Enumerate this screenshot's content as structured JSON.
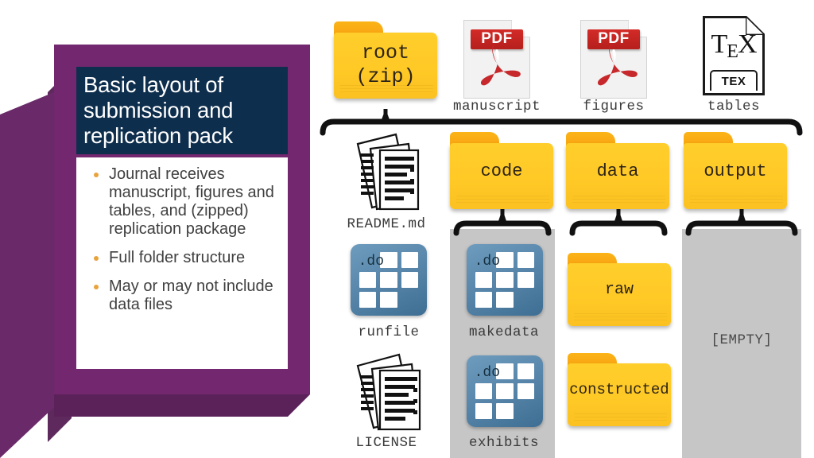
{
  "slide": {
    "title": "Basic layout of submission and replication pack",
    "bullets": [
      "Journal receives manuscript, figures and tables, and (zipped) replication package",
      "Full folder structure",
      "May or may not include data files"
    ],
    "colors": {
      "purple": "#72276F",
      "purple_shadow": "#5E2A5E",
      "navy": "#0E2E4D",
      "bullet_accent": "#E8A33D",
      "folder_body": "#FFCE2B",
      "folder_tab": "#F79C10",
      "pdf_red": "#C32421",
      "do_blue": "#4E7FA4",
      "grey_panel": "#C6C6C6"
    }
  },
  "tree": {
    "root": {
      "label": "root\n(zip)",
      "line1": "root",
      "line2": "(zip)",
      "icon": "folder-icon"
    },
    "top_row": [
      {
        "name": "manuscript",
        "icon": "pdf-file-icon",
        "badge": "PDF"
      },
      {
        "name": "figures",
        "icon": "pdf-file-icon",
        "badge": "PDF"
      },
      {
        "name": "tables",
        "icon": "tex-file-icon",
        "badge": "TEX",
        "glyph_main": "T",
        "glyph_sub": "E",
        "glyph_end": "X"
      }
    ],
    "level2": [
      {
        "name": "README.md",
        "icon": "document-stack-icon",
        "type": "file"
      },
      {
        "name": "code",
        "icon": "folder-icon",
        "type": "folder"
      },
      {
        "name": "data",
        "icon": "folder-icon",
        "type": "folder"
      },
      {
        "name": "output",
        "icon": "folder-icon",
        "type": "folder"
      }
    ],
    "column_left_extra": [
      {
        "name": "runfile",
        "icon": "do-file-icon",
        "ext": ".do"
      },
      {
        "name": "LICENSE",
        "icon": "document-stack-icon"
      }
    ],
    "code_children": [
      {
        "name": "makedata",
        "icon": "do-file-icon",
        "ext": ".do"
      },
      {
        "name": "exhibits",
        "icon": "do-file-icon",
        "ext": ".do"
      }
    ],
    "data_children": [
      {
        "name": "raw",
        "icon": "folder-icon"
      },
      {
        "name": "constructed",
        "icon": "folder-icon"
      }
    ],
    "output_children": [],
    "output_placeholder": "[EMPTY]"
  }
}
